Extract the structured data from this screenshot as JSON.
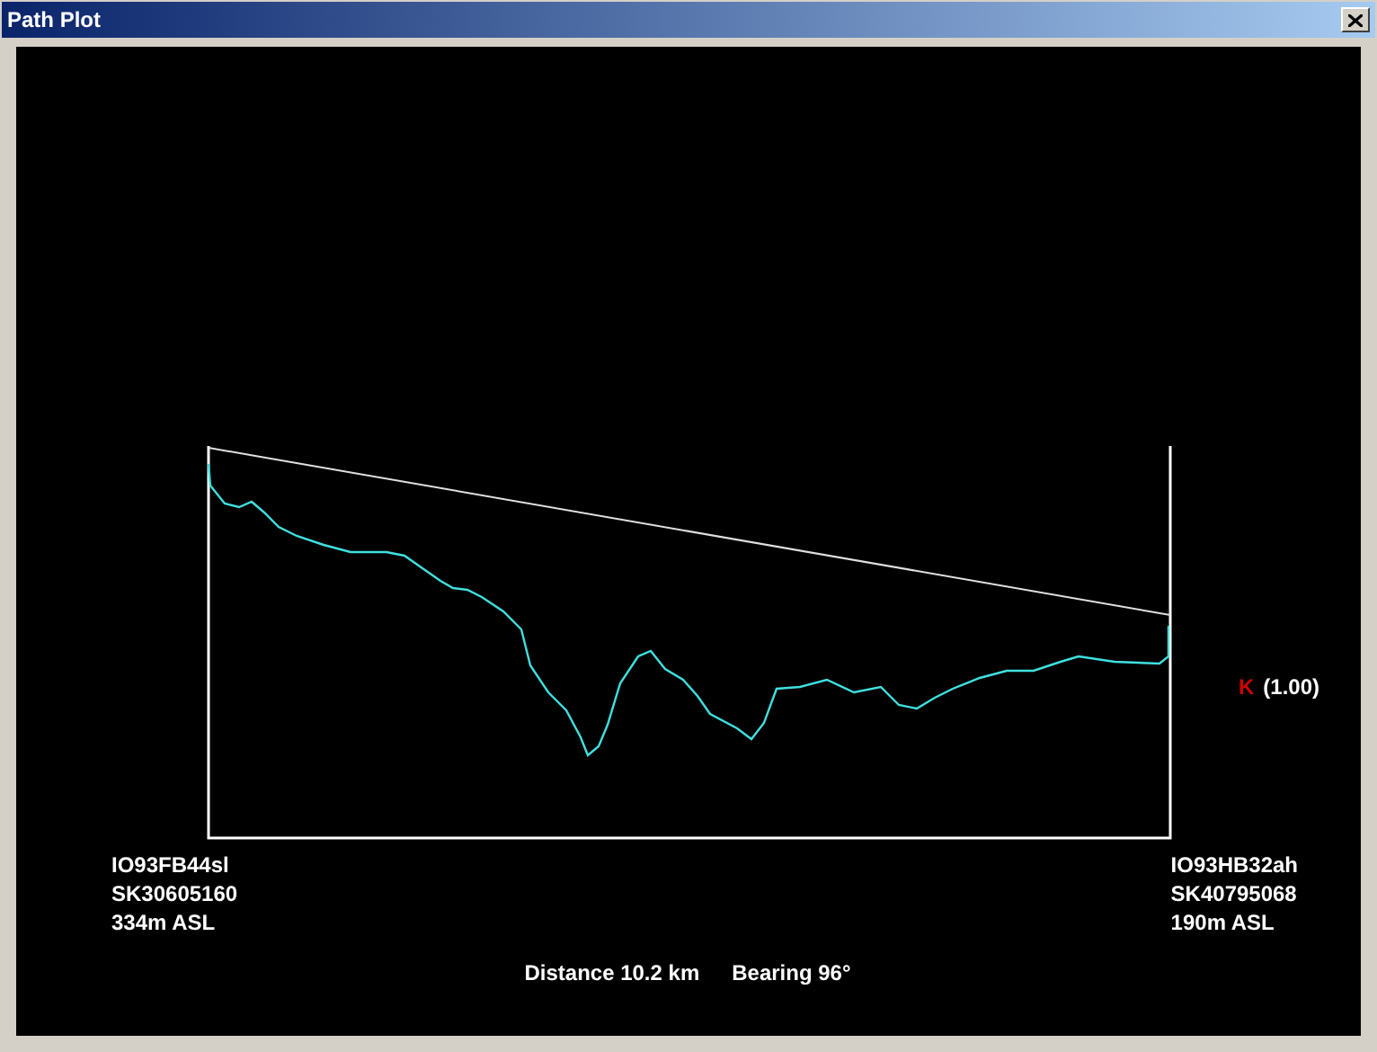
{
  "window": {
    "title": "Path Plot"
  },
  "k_factor": {
    "label": "K",
    "value": "(1.00)"
  },
  "endpoints": [
    {
      "locator": "IO93FB44sl",
      "grid_ref": "SK30605160",
      "elevation": "334m ASL"
    },
    {
      "locator": "IO93HB32ah",
      "grid_ref": "SK40795068",
      "elevation": "190m ASL"
    }
  ],
  "summary": {
    "distance": "Distance 10.2 km",
    "bearing": "Bearing 96°"
  }
}
